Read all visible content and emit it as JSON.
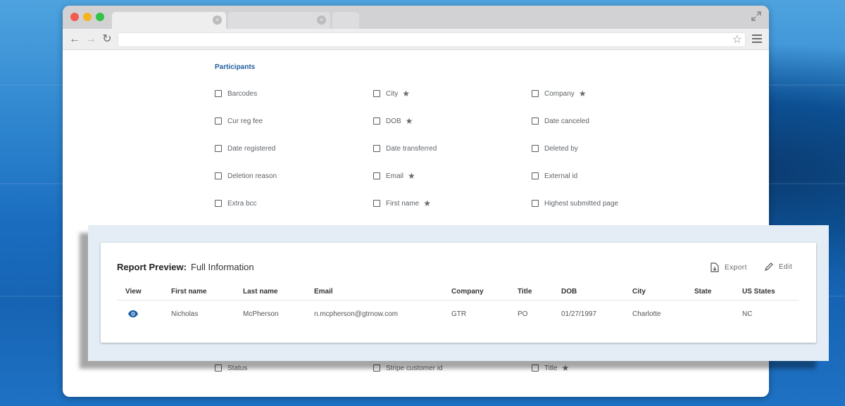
{
  "browser": {
    "url": ""
  },
  "participants": {
    "title": "Participants",
    "fields": [
      {
        "label": "Barcodes",
        "starred": false
      },
      {
        "label": "City",
        "starred": true
      },
      {
        "label": "Company",
        "starred": true
      },
      {
        "label": "Cur reg fee",
        "starred": false
      },
      {
        "label": "DOB",
        "starred": true
      },
      {
        "label": "Date canceled",
        "starred": false
      },
      {
        "label": "Date registered",
        "starred": false
      },
      {
        "label": "Date transferred",
        "starred": false
      },
      {
        "label": "Deleted by",
        "starred": false
      },
      {
        "label": "Deletion reason",
        "starred": false
      },
      {
        "label": "Email",
        "starred": true
      },
      {
        "label": "External id",
        "starred": false
      },
      {
        "label": "Extra bcc",
        "starred": false
      },
      {
        "label": "First name",
        "starred": true
      },
      {
        "label": "Highest submitted page",
        "starred": false
      },
      {
        "label": "Status",
        "starred": false
      },
      {
        "label": "Stripe customer id",
        "starred": false
      },
      {
        "label": "Title",
        "starred": true
      }
    ]
  },
  "preview": {
    "title": "Report Preview:",
    "subtitle": "Full Information",
    "export_label": "Export",
    "edit_label": "Edit",
    "columns": [
      "View",
      "First name",
      "Last name",
      "Email",
      "Company",
      "Title",
      "DOB",
      "City",
      "State",
      "US States"
    ],
    "rows": [
      [
        "",
        "Nicholas",
        "McPherson",
        "n.mcpherson@gtrnow.com",
        "GTR",
        "PO",
        "01/27/1997",
        "Charlotte",
        "",
        "NC"
      ]
    ]
  },
  "colors": {
    "accent": "#1f5d9c",
    "eye_icon": "#1a5fa8"
  },
  "icons": {
    "star": "star-icon",
    "view": "eye-icon",
    "export": "file-export-icon",
    "edit": "pencil-icon"
  }
}
